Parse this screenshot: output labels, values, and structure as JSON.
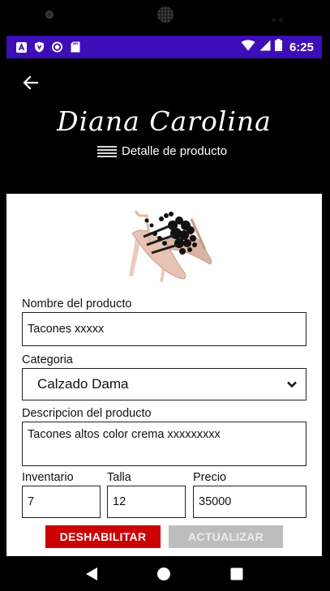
{
  "status_bar": {
    "time": "6:25",
    "left_icons": [
      "notification-a-icon",
      "shield-icon",
      "record-icon",
      "sd-card-icon"
    ],
    "right_icons": [
      "wifi-icon",
      "signal-icon",
      "battery-icon"
    ],
    "color": "#3d0eb8"
  },
  "header": {
    "brand": "Diana Carolina",
    "subtitle": "Detalle de producto",
    "back_icon": "arrow-back-icon"
  },
  "form": {
    "name_label": "Nombre del producto",
    "name_value": "Tacones xxxxx",
    "category_label": "Categoria",
    "category_value": "Calzado Dama",
    "description_label": "Descripcion del producto",
    "description_value": "Tacones altos color crema xxxxxxxxx",
    "inventory_label": "Inventario",
    "inventory_value": "7",
    "size_label": "Talla",
    "size_value": "12",
    "price_label": "Precio",
    "price_value": "35000"
  },
  "actions": {
    "disable_label": "DESHABILITAR",
    "update_label": "ACTUALIZAR",
    "disable_color": "#cc0000",
    "update_color": "#bdbdbd"
  },
  "nav": {
    "icons": [
      "back-triangle-icon",
      "home-circle-icon",
      "recents-square-icon"
    ]
  }
}
